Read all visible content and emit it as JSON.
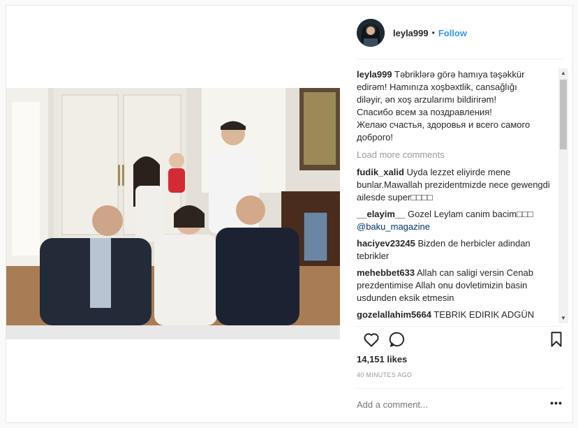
{
  "header": {
    "username": "leyla999",
    "separator": "•",
    "follow_label": "Follow"
  },
  "caption": {
    "username": "leyla999",
    "lines": [
      "Təbriklərə görə hamıya təşəkkür",
      "edirəm! Hamınıza xoşbəxtlik, cansağlığı",
      "diləyir, ən xoş arzularımı bildirirəm!",
      "Спасибо всем за поздравления!",
      "Желаю счастья, здоровья и всего самого",
      "доброго!"
    ]
  },
  "load_more_label": "Load more comments",
  "comments": [
    {
      "username": "fudik_xalid",
      "text": "Uyda lezzet eliyirde mene bunlar.Mawallah prezidentmizde nece gewengdi ailesde super□□□□"
    },
    {
      "username": "__elayim__",
      "text": "Gozel Leylam canim bacim□□□",
      "mention": "@baku_magazine"
    },
    {
      "username": "haciyev23245",
      "text": "Bizden de herbicler adindan tebrikler"
    },
    {
      "username": "mehebbet633",
      "text": "Allah can saligi versin Cenab prezdentimise Allah onu dovletimizin basin usdunden eksik etmesin"
    },
    {
      "username": "gozelallahim5664",
      "text": "TEBRIK EDIRIK ADGÜN"
    }
  ],
  "likes": "14,151 likes",
  "time": "40 MINUTES AGO",
  "add_comment_placeholder": "Add a comment...",
  "more_label": "•••",
  "icons": {
    "like": "heart-icon",
    "comment": "comment-icon",
    "save": "bookmark-icon",
    "more": "ellipsis-icon"
  }
}
